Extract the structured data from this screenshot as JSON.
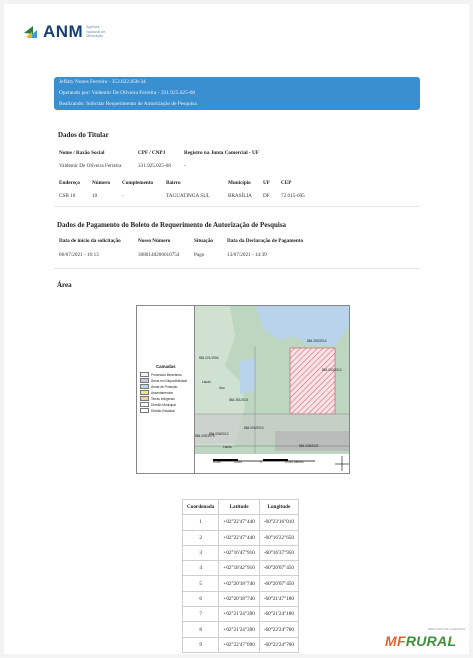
{
  "brand": {
    "name": "ANM",
    "tagline": [
      "Agência",
      "Nacional de",
      "Mineração"
    ]
  },
  "banner": {
    "line1": "Jeffaty Nunes Ferreira - 353.822.858-34",
    "line2": "Operando por: Valdemir De Oliveira Ferreira - 331.925.025-68",
    "line3": "Realizando: Solicitar Requerimento de Autorização de Pesquisa"
  },
  "titular": {
    "title": "Dados do Titular",
    "headers": {
      "nome": "Nome / Razão Social",
      "cpf": "CPF / CNPJ",
      "registro": "Registro na Junta Comercial - UF"
    },
    "values": {
      "nome": "Valdemir De Oliveira Ferreira",
      "cpf": "331.925.025-68",
      "registro": "-"
    },
    "addr_headers": {
      "endereco": "Endereço",
      "numero": "Número",
      "complemento": "Complemento",
      "bairro": "Bairro",
      "municipio": "Município",
      "uf": "UF",
      "cep": "CEP"
    },
    "addr_values": {
      "endereco": "CSB 10",
      "numero": "10",
      "complemento": "-",
      "bairro": "TAGUATINGA SUL",
      "municipio": "BRASÍLIA",
      "uf": "DF",
      "cep": "72.015-605"
    }
  },
  "pagamento": {
    "title": "Dados de Pagamento do Boleto de Requerimento de Autorização de Pesquisa",
    "headers": {
      "data": "Data de início da solicitação",
      "nosso": "Nosso Número",
      "situacao": "Situação",
      "declaracao": "Data da Declaração de Pagamento"
    },
    "values": {
      "data": "06/07/2021 - 16:13",
      "nosso": "308014020061075­4",
      "situacao": "Pago",
      "declaracao": "13/07/2021 - 14:39"
    }
  },
  "area": {
    "title": "Área",
    "legend_title": "Camadas",
    "legend": [
      {
        "label": "Processos Minerários",
        "color": "#f4f4f4"
      },
      {
        "label": "Áreas em Disponibilidade",
        "color": "#cfc2e3"
      },
      {
        "label": "Áreas de Proteção",
        "color": "#b8d7ef"
      },
      {
        "label": "Assentamentos",
        "color": "#f3e08a"
      },
      {
        "label": "Terras Indígenas",
        "color": "#e9d0a6"
      },
      {
        "label": "Divisão Municipal",
        "color": "#ffffff"
      },
      {
        "label": "Divisão Estadual",
        "color": "#ffffff"
      }
    ],
    "map_labels": [
      "884.021/1994",
      "884.250/2014",
      "884.050/2013",
      "884.351/2021",
      "884.006/2012",
      "884.003/2010",
      "884.008/2021",
      "Laudo",
      "884.005/1975",
      "Uso",
      "Laudo"
    ],
    "scale_labels": [
      "6.050",
      "3.025",
      "0",
      "6.050 Metros"
    ]
  },
  "coords": {
    "headers": [
      "Coordenada",
      "Latitude",
      "Longitude"
    ],
    "rows": [
      [
        "1",
        "+02°22'47\"440",
        "-60°23'16\"010"
      ],
      [
        "2",
        "+02°22'47\"440",
        "-60°16'22\"650"
      ],
      [
        "3",
        "+02°16'47\"910",
        "-60°16'37\"950"
      ],
      [
        "4",
        "+02°18'42\"910",
        "-60°20'07\"450"
      ],
      [
        "5",
        "+02°20'18\"740",
        "-60°20'07\"450"
      ],
      [
        "6",
        "+02°20'18\"740",
        "-60°21'47\"180"
      ],
      [
        "7",
        "+02°21'24\"390",
        "-60°21'24\"180"
      ],
      [
        "8",
        "+02°21'24\"390",
        "-60°22'24\"700"
      ],
      [
        "9",
        "+02°22'47\"090",
        "-60°22'24\"700"
      ]
    ]
  },
  "watermark": {
    "part1": "MF",
    "part2": "RURAL",
    "sub": "MERCADO DE FAZENDAS"
  }
}
